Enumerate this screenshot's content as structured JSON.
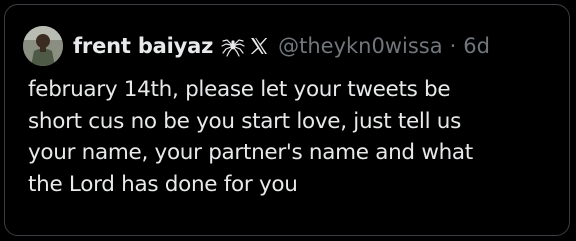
{
  "tweet": {
    "display_name": "frent baiyaz",
    "badge_icons": [
      "spider-icon",
      "x-logo-icon"
    ],
    "handle": "@theykn0wissa",
    "separator": "·",
    "time_ago": "6d",
    "text_lines": [
      "february 14th, please let your tweets be",
      "short cus no be you start love, just tell us",
      "your name, your partner's name and what",
      "the Lord has done for you"
    ]
  },
  "colors": {
    "background": "#000000",
    "border": "#3a3d42",
    "primary_text": "#e7e9ea",
    "secondary_text": "#71767b"
  }
}
